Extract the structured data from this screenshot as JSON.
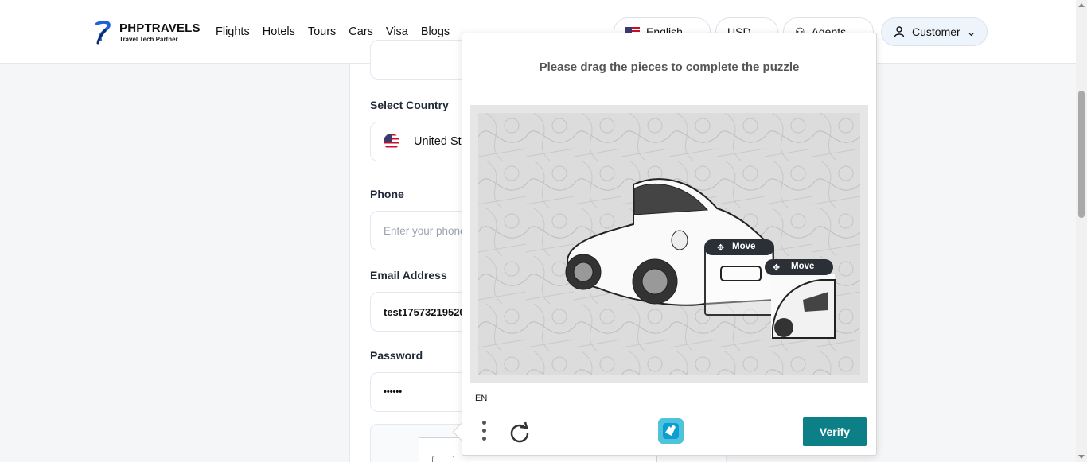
{
  "brand": {
    "title": "PHPTRAVELS",
    "subtitle": "Travel Tech Partner"
  },
  "nav": [
    "Flights",
    "Hotels",
    "Tours",
    "Cars",
    "Visa",
    "Blogs"
  ],
  "header_controls": {
    "language": "English",
    "currency": "USD",
    "agents": "Agents",
    "customer": "Customer"
  },
  "form": {
    "country_label": "Select Country",
    "country_value": "United St",
    "phone_label": "Phone",
    "phone_placeholder": "Enter your phone",
    "email_label": "Email Address",
    "email_value": "test17573219520",
    "password_label": "Password",
    "password_value": "••••••"
  },
  "puzzle": {
    "prompt": "Please drag the pieces to complete the puzzle",
    "move_label_1": "Move",
    "move_label_2": "Move",
    "language": "EN",
    "verify_label": "Verify"
  },
  "colors": {
    "verify_bg": "#0d7f86",
    "accent_blue": "#1e63d6"
  }
}
